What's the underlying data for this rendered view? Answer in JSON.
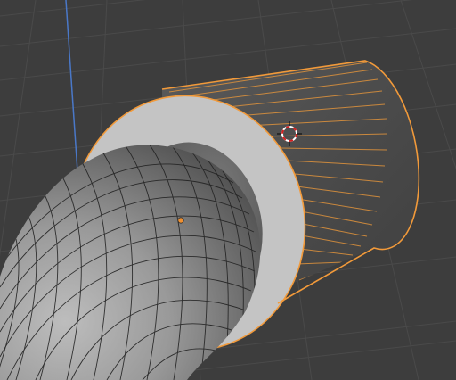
{
  "viewport": {
    "name": "3D Viewport",
    "colors": {
      "background": "#3d3d3d",
      "grid_line": "#4a4a4a",
      "z_axis": "#4a78c8",
      "selection_outline": "#f29a3a",
      "selected_edge": "#e0933c",
      "cylinder_side": "#4c4c4c",
      "cylinder_cap": "#c4c4c4",
      "pipe_light": "#b8b8b8",
      "pipe_dark": "#4e4e4e",
      "wire": "#222222",
      "object_origin": "#f09030",
      "cursor_red": "#d22020"
    },
    "objects": [
      {
        "name": "pipe",
        "role": "curved tube mesh",
        "selected": false
      },
      {
        "name": "cylinder",
        "role": "hollow cylinder mesh",
        "selected": true
      }
    ],
    "icons": [
      "3d-cursor-icon",
      "object-origin-icon"
    ]
  }
}
